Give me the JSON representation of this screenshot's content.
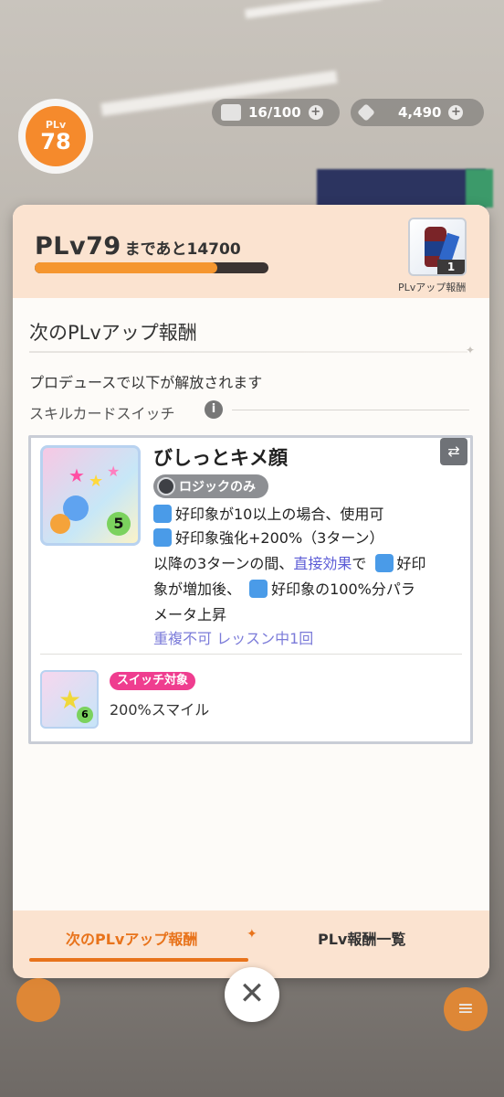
{
  "status": {
    "plv_label": "PLv",
    "plv_value": "78",
    "stamina": "16/100",
    "gems": "4,490"
  },
  "header": {
    "level": "PLv79",
    "remaining": "まであと14700",
    "progress_fraction": 0.78,
    "reward_count": "1",
    "reward_caption": "PLvアップ報酬"
  },
  "section": {
    "title": "次のPLvアップ報酬",
    "unlock_text": "プロデュースで以下が解放されます",
    "switch_label": "スキルカードスイッチ"
  },
  "card": {
    "name": "びしっとキメ顔",
    "tag": "ロジックのみ",
    "cost": "5",
    "effects": {
      "line1": "好印象が10以上の場合、使用可",
      "line2": "好印象強化+200%（3ターン）",
      "line3a": "以降の3ターンの間、",
      "line3b": "直接効果",
      "line3c": "で",
      "line3d": "好印",
      "line4a": "象が増加後、",
      "line4b": "好印象の100%分パラ",
      "line5": "メータ上昇",
      "condition": "重複不可 レッスン中1回"
    }
  },
  "switch_target": {
    "tag": "スイッチ対象",
    "name": "200%スマイル",
    "cost": "6"
  },
  "tabs": {
    "active": "次のPLvアップ報酬",
    "inactive": "PLv報酬一覧"
  },
  "colors": {
    "accent": "#e8731b",
    "panel_head": "#fbe3d0",
    "switch_tag": "#ef3d8f",
    "highlight_text": "#5b5bd6"
  }
}
